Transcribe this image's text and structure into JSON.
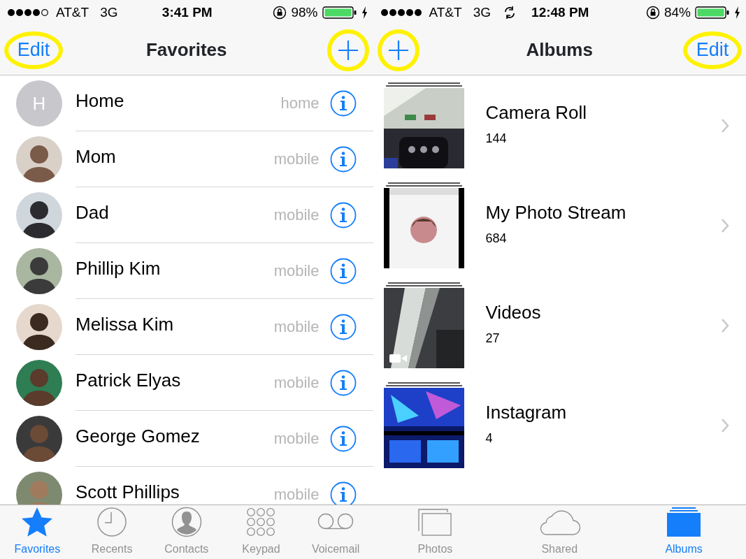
{
  "phone_favorites": {
    "status_bar": {
      "carrier": "AT&T",
      "network": "3G",
      "syncing": false,
      "time": "3:41 PM",
      "battery": "98%"
    },
    "nav": {
      "title": "Favorites",
      "left": {
        "kind": "text",
        "label": "Edit",
        "highlighted": true
      },
      "right": {
        "kind": "plus",
        "highlighted": true
      }
    },
    "favorites": [
      {
        "avatar": {
          "kind": "initial",
          "initial": "H"
        },
        "name": "Home",
        "label": "home"
      },
      {
        "name": "Mom",
        "label": "mobile"
      },
      {
        "name": "Dad",
        "label": "mobile"
      },
      {
        "name": "Phillip Kim",
        "label": "mobile"
      },
      {
        "name": "Melissa Kim",
        "label": "mobile"
      },
      {
        "name": "Patrick Elyas",
        "label": "mobile"
      },
      {
        "name": "George Gomez",
        "label": "mobile"
      },
      {
        "name": "Scott Phillips",
        "label": "mobile"
      }
    ],
    "tab_bar": [
      {
        "kind": "star",
        "label": "Favorites",
        "selected": true
      },
      {
        "kind": "clock",
        "label": "Recents",
        "selected": false
      },
      {
        "kind": "contact",
        "label": "Contacts",
        "selected": false
      },
      {
        "kind": "keypad",
        "label": "Keypad",
        "selected": false
      },
      {
        "kind": "voicemail",
        "label": "Voicemail",
        "selected": false
      }
    ]
  },
  "phone_albums": {
    "status_bar": {
      "carrier": "AT&T",
      "network": "3G",
      "syncing": true,
      "time": "12:48 PM",
      "battery": "84%"
    },
    "nav": {
      "title": "Albums",
      "left": {
        "kind": "plus",
        "highlighted": true
      },
      "right": {
        "kind": "text",
        "label": "Edit",
        "highlighted": true
      }
    },
    "albums": [
      {
        "name": "Camera Roll",
        "count": "144",
        "video_badge": false
      },
      {
        "name": "My Photo Stream",
        "count": "684",
        "video_badge": false
      },
      {
        "name": "Videos",
        "count": "27",
        "video_badge": true
      },
      {
        "name": "Instagram",
        "count": "4",
        "video_badge": false
      }
    ],
    "tab_bar": [
      {
        "kind": "photos",
        "label": "Photos",
        "selected": false
      },
      {
        "kind": "cloud",
        "label": "Shared",
        "selected": false
      },
      {
        "kind": "albums",
        "label": "Albums",
        "selected": true
      }
    ]
  }
}
